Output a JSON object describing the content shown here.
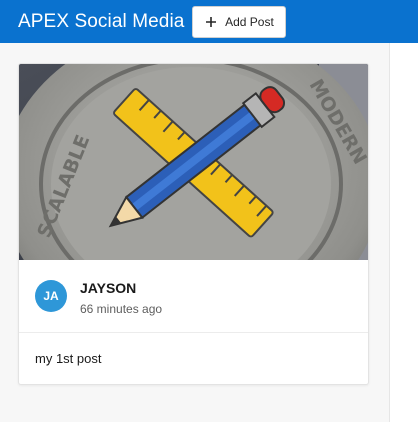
{
  "header": {
    "title": "APEX Social Media",
    "add_post_label": "Add Post",
    "add_post_icon": "plus-icon",
    "background": "#0a72cf"
  },
  "post": {
    "image_icon": "pencil-ruler-coin-image",
    "image_text": {
      "left": "SCALABLE",
      "right": "MODERN"
    },
    "avatar_initials": "JA",
    "avatar_color": "#2e97d8",
    "author": "JAYSON",
    "timestamp": "66 minutes ago",
    "body": "my 1st post"
  }
}
